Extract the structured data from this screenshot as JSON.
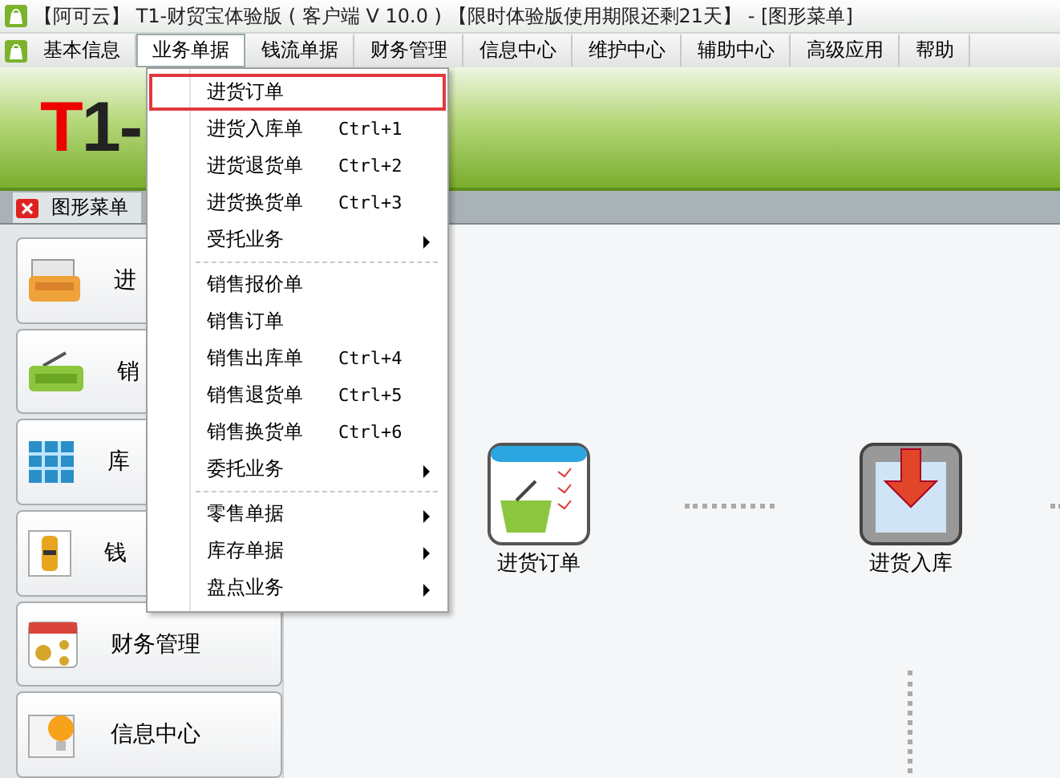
{
  "window": {
    "title": "【阿可云】 T1-财贸宝体验版 ( 客户端 V 10.0 ) 【限时体验版使用期限还剩21天】 - [图形菜单]"
  },
  "menubar": [
    {
      "label": "基本信息",
      "selected": false
    },
    {
      "label": "业务单据",
      "selected": true
    },
    {
      "label": "钱流单据",
      "selected": false
    },
    {
      "label": "财务管理",
      "selected": false
    },
    {
      "label": "信息中心",
      "selected": false
    },
    {
      "label": "维护中心",
      "selected": false
    },
    {
      "label": "辅助中心",
      "selected": false
    },
    {
      "label": "高级应用",
      "selected": false
    },
    {
      "label": "帮助",
      "selected": false
    }
  ],
  "banner": {
    "logo": "T1-"
  },
  "tabs": [
    {
      "label": "图形菜单",
      "selected": true
    }
  ],
  "sidebar": {
    "items": [
      {
        "label": "进",
        "kind": "purchase"
      },
      {
        "label": "销",
        "kind": "sales"
      },
      {
        "label": "库",
        "kind": "stock"
      },
      {
        "label": "钱",
        "kind": "money"
      },
      {
        "label": "财务管理",
        "kind": "finance"
      },
      {
        "label": "信息中心",
        "kind": "info"
      }
    ]
  },
  "dropdown": {
    "items": [
      {
        "kind": "item",
        "label": "进货订单",
        "selected": true
      },
      {
        "kind": "item",
        "label": "进货入库单",
        "shortcut": "Ctrl+1",
        "selected": false
      },
      {
        "kind": "item",
        "label": "进货退货单",
        "shortcut": "Ctrl+2",
        "selected": false
      },
      {
        "kind": "item",
        "label": "进货换货单",
        "shortcut": "Ctrl+3",
        "selected": false
      },
      {
        "kind": "submenu",
        "label": "受托业务",
        "selected": false
      },
      {
        "kind": "separator"
      },
      {
        "kind": "item",
        "label": "销售报价单",
        "selected": false
      },
      {
        "kind": "item",
        "label": "销售订单",
        "selected": false
      },
      {
        "kind": "item",
        "label": "销售出库单",
        "shortcut": "Ctrl+4",
        "selected": false
      },
      {
        "kind": "item",
        "label": "销售退货单",
        "shortcut": "Ctrl+5",
        "selected": false
      },
      {
        "kind": "item",
        "label": "销售换货单",
        "shortcut": "Ctrl+6",
        "selected": false
      },
      {
        "kind": "submenu",
        "label": "委托业务",
        "selected": false
      },
      {
        "kind": "separator"
      },
      {
        "kind": "submenu",
        "label": "零售单据",
        "selected": false
      },
      {
        "kind": "submenu",
        "label": "库存单据",
        "selected": false
      },
      {
        "kind": "submenu",
        "label": "盘点业务",
        "selected": false
      }
    ]
  },
  "canvas": {
    "nodes": [
      {
        "label": "进货订单",
        "kind": "order"
      },
      {
        "label": "进货入库",
        "kind": "inbound"
      }
    ]
  }
}
